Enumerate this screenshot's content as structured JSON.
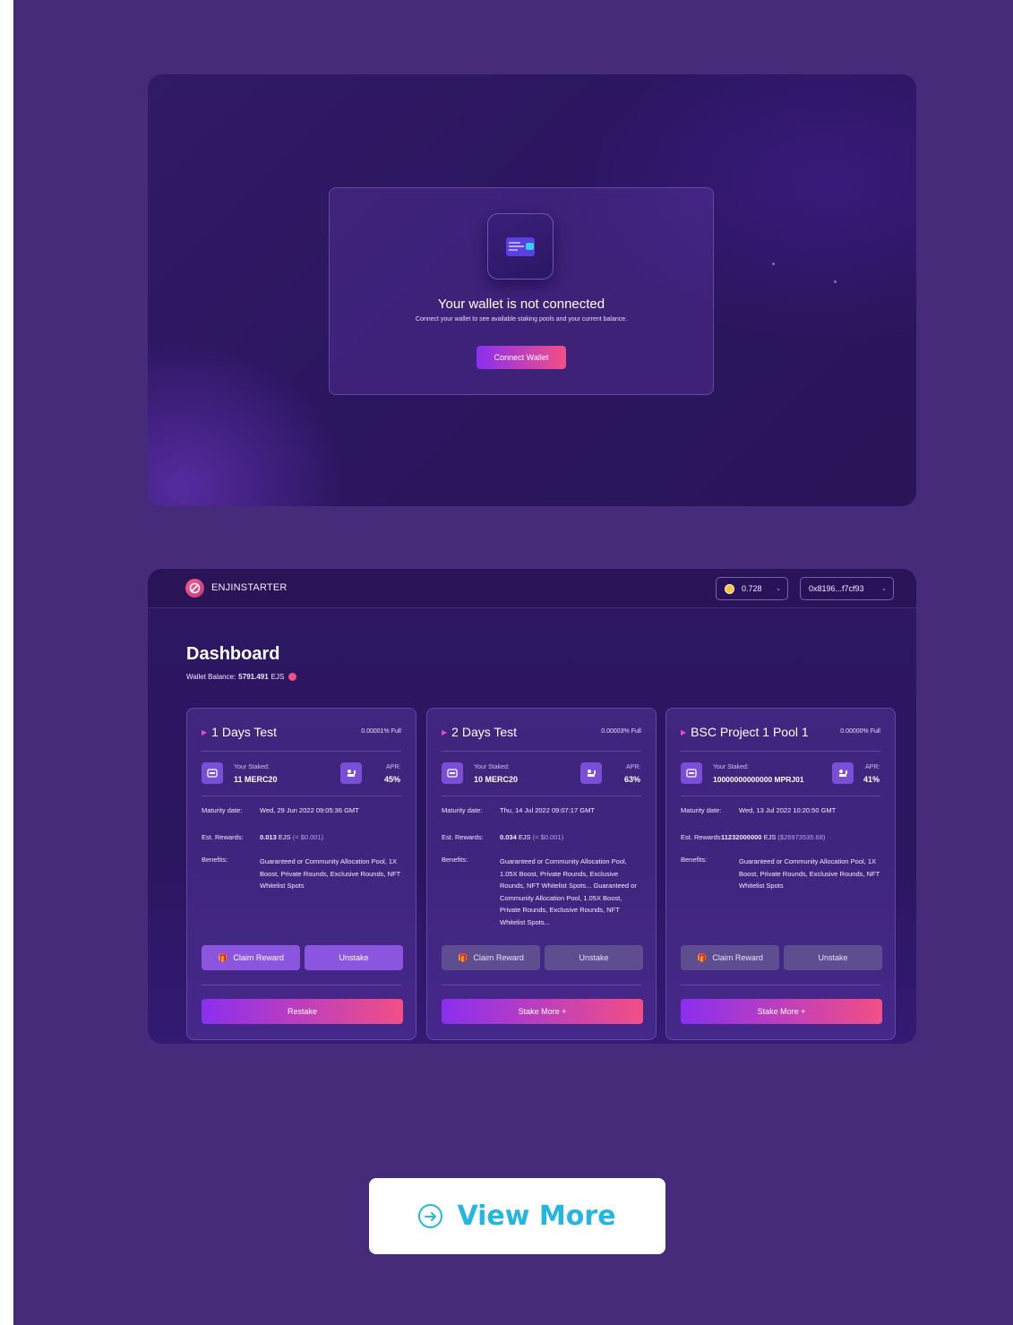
{
  "colors": {
    "background": "#452b7a",
    "accent_gradient_start": "#8a2ff0",
    "accent_gradient_end": "#f24f86",
    "view_more_text": "#22b6e3"
  },
  "wallet_prompt": {
    "icon": "wallet-icon",
    "title": "Your wallet is not connected",
    "subtitle": "Connect your wallet to see available staking pools and your current balance.",
    "connect_label": "Connect Wallet"
  },
  "navbar": {
    "logo_text": "ENJINSTARTER",
    "balance": "0.728",
    "address": "0x8196...f7cf93"
  },
  "dashboard": {
    "title": "Dashboard",
    "wallet_balance_label": "Wallet Balance:",
    "wallet_balance_value": "5791.491",
    "wallet_balance_unit": "EJS"
  },
  "pools": [
    {
      "name": "1 Days Test",
      "full": "0.00001% Full",
      "staked_label": "Your Staked:",
      "staked_value": "11 MERC20",
      "apr_label": "APR:",
      "apr_value": "45%",
      "maturity_label": "Maturity date:",
      "maturity_value": "Wed, 29 Jun 2022 09:05:36 GMT",
      "rewards_label": "Est. Rewards:",
      "rewards_value": "0.013",
      "rewards_unit": "EJS",
      "rewards_usd": "(< $0.001)",
      "benefits_label": "Benefits:",
      "benefits_value": "Guaranteed or Community Allocation Pool, 1X Boost, Private Rounds, Exclusive Rounds, NFT Whitelist Spots",
      "claim_label": "Claim Reward",
      "unstake_label": "Unstake",
      "wide_label": "Restake"
    },
    {
      "name": "2 Days Test",
      "full": "0.00003% Full",
      "staked_label": "Your Staked:",
      "staked_value": "10 MERC20",
      "apr_label": "APR:",
      "apr_value": "63%",
      "maturity_label": "Maturity date:",
      "maturity_value": "Thu, 14 Jul 2022 09:07:17 GMT",
      "rewards_label": "Est. Rewards:",
      "rewards_value": "0.034",
      "rewards_unit": "EJS",
      "rewards_usd": "(< $0.001)",
      "benefits_label": "Benefits:",
      "benefits_value": "Guaranteed or Community Allocation Pool, 1.05X Boost, Private Rounds, Exclusive Rounds, NFT Whitelist Spots... Guaranteed or Community Allocation Pool, 1.05X Boost, Private Rounds, Exclusive Rounds, NFT Whitelist Spots...",
      "claim_label": "Claim Reward",
      "unstake_label": "Unstake",
      "wide_label": "Stake More +"
    },
    {
      "name": "BSC Project 1 Pool 1",
      "full": "0.00000% Full",
      "staked_label": "Your Staked:",
      "staked_value": "10000000000000 MPRJ01",
      "apr_label": "APR:",
      "apr_value": "41%",
      "maturity_label": "Maturity date:",
      "maturity_value": "Wed, 13 Jul 2022 10:20:50 GMT",
      "rewards_label": "Est. Rewards:",
      "rewards_value": "11232000000",
      "rewards_unit": "EJS",
      "rewards_usd": "($26973535.68)",
      "benefits_label": "Benefits:",
      "benefits_value": "Guaranteed or Community Allocation Pool, 1X Boost, Private Rounds, Exclusive Rounds, NFT Whitelist Spots",
      "claim_label": "Claim Reward",
      "unstake_label": "Unstake",
      "wide_label": "Stake More +"
    }
  ],
  "view_more": {
    "label": "View More",
    "icon": "arrow-right-circle-icon"
  }
}
